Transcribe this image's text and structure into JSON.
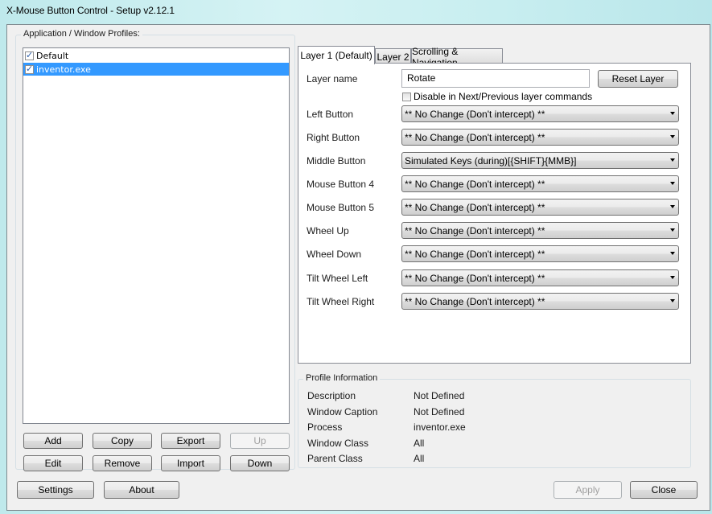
{
  "window": {
    "title": "X-Mouse Button Control - Setup v2.12.1"
  },
  "profiles": {
    "label": "Application / Window Profiles:",
    "items": [
      {
        "name": "Default",
        "checked": true,
        "selected": false
      },
      {
        "name": "inventor.exe",
        "checked": true,
        "selected": true
      }
    ],
    "buttons": {
      "add": "Add",
      "copy": "Copy",
      "export": "Export",
      "up": "Up",
      "edit": "Edit",
      "remove": "Remove",
      "import": "Import",
      "down": "Down"
    }
  },
  "tabs": [
    {
      "label": "Layer 1 (Default)",
      "active": true
    },
    {
      "label": "Layer 2",
      "active": false
    },
    {
      "label": "Scrolling & Navigation",
      "active": false
    }
  ],
  "layer": {
    "name_label": "Layer name",
    "name_value": "Rotate",
    "reset_label": "Reset Layer",
    "disable_label": "Disable in Next/Previous layer commands",
    "disable_checked": false,
    "mappings": [
      {
        "label": "Left Button",
        "value": "** No Change (Don't intercept) **"
      },
      {
        "label": "Right Button",
        "value": "** No Change (Don't intercept) **"
      },
      {
        "label": "Middle Button",
        "value": "Simulated Keys (during)[{SHIFT}{MMB}]"
      },
      {
        "label": "Mouse Button 4",
        "value": "** No Change (Don't intercept) **"
      },
      {
        "label": "Mouse Button 5",
        "value": "** No Change (Don't intercept) **"
      },
      {
        "label": "Wheel Up",
        "value": "** No Change (Don't intercept) **"
      },
      {
        "label": "Wheel Down",
        "value": "** No Change (Don't intercept) **"
      },
      {
        "label": "Tilt Wheel Left",
        "value": "** No Change (Don't intercept) **"
      },
      {
        "label": "Tilt Wheel Right",
        "value": "** No Change (Don't intercept) **"
      }
    ]
  },
  "profile_info": {
    "label": "Profile Information",
    "rows": [
      {
        "label": "Description",
        "value": "Not Defined"
      },
      {
        "label": "Window Caption",
        "value": "Not Defined"
      },
      {
        "label": "Process",
        "value": "inventor.exe"
      },
      {
        "label": "Window Class",
        "value": "All"
      },
      {
        "label": "Parent Class",
        "value": "All"
      }
    ]
  },
  "footer": {
    "settings": "Settings",
    "about": "About",
    "apply": "Apply",
    "close": "Close"
  }
}
